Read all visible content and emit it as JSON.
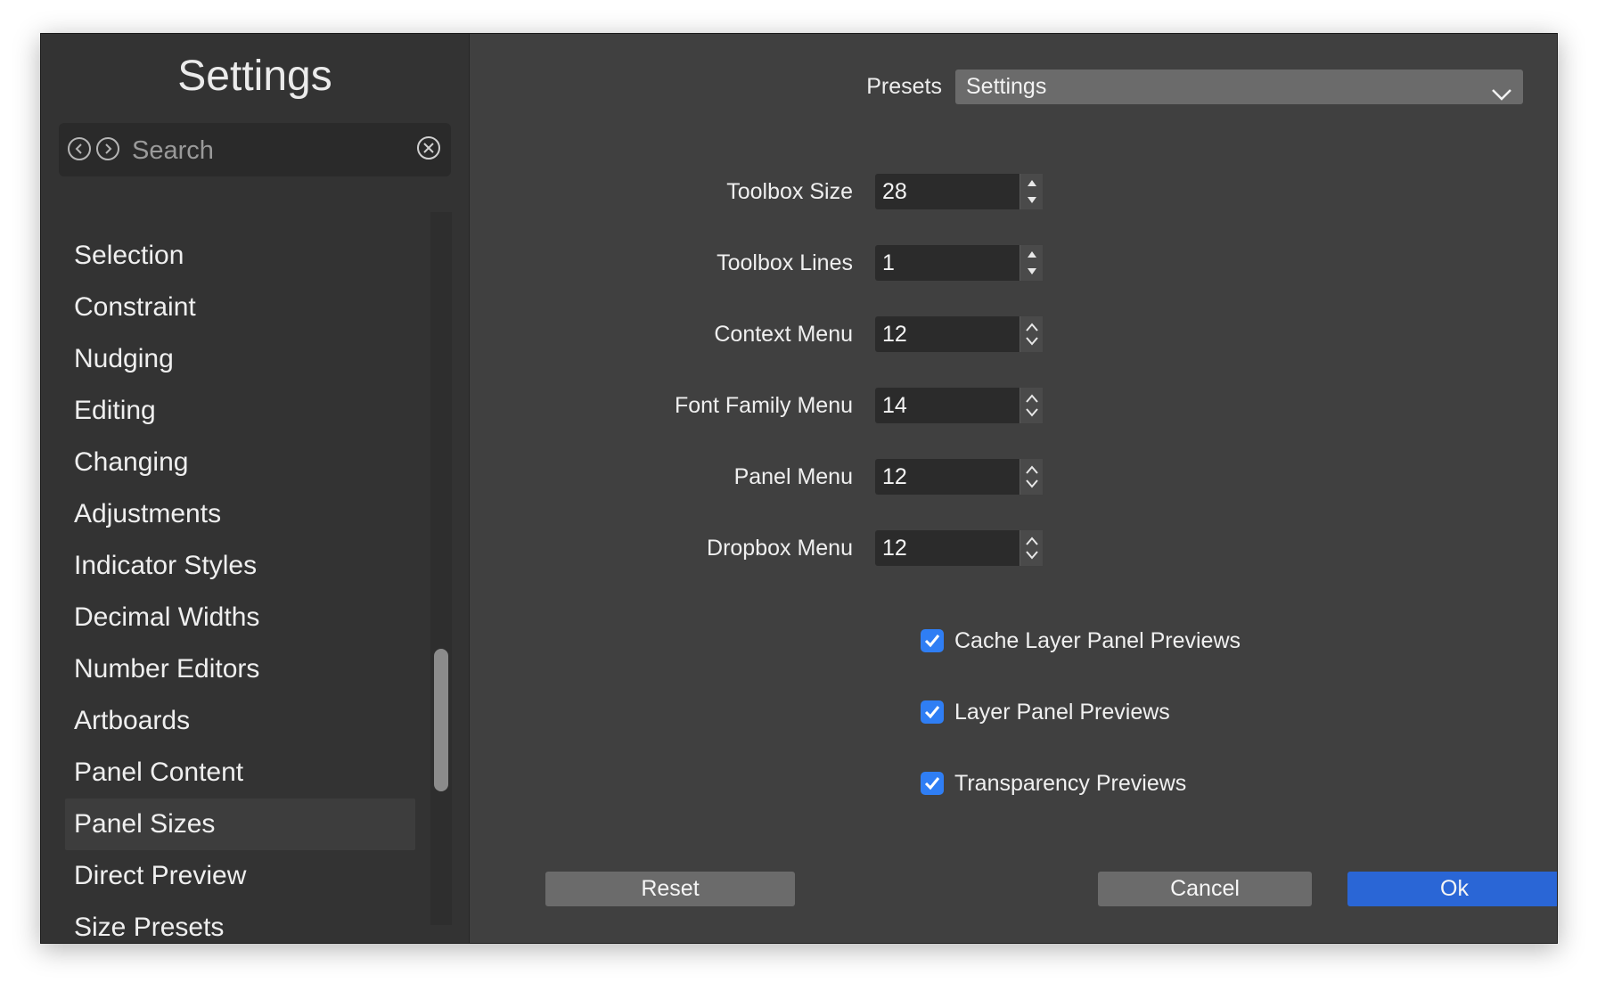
{
  "sidebar": {
    "title": "Settings",
    "search": {
      "placeholder": "Search"
    },
    "items": [
      {
        "label": "Selection"
      },
      {
        "label": "Constraint"
      },
      {
        "label": "Nudging"
      },
      {
        "label": "Editing"
      },
      {
        "label": "Changing"
      },
      {
        "label": "Adjustments"
      },
      {
        "label": "Indicator Styles"
      },
      {
        "label": "Decimal Widths"
      },
      {
        "label": "Number Editors"
      },
      {
        "label": "Artboards"
      },
      {
        "label": "Panel Content"
      },
      {
        "label": "Panel Sizes"
      },
      {
        "label": "Direct Preview"
      },
      {
        "label": "Size Presets"
      }
    ],
    "active_item": "Panel Sizes"
  },
  "presets": {
    "label": "Presets",
    "value": "Settings"
  },
  "fields": [
    {
      "label": "Toolbox Size",
      "value": "28",
      "stepper": "arrows"
    },
    {
      "label": "Toolbox Lines",
      "value": "1",
      "stepper": "arrows"
    },
    {
      "label": "Context Menu",
      "value": "12",
      "stepper": "chevrons"
    },
    {
      "label": "Font Family Menu",
      "value": "14",
      "stepper": "chevrons"
    },
    {
      "label": "Panel Menu",
      "value": "12",
      "stepper": "chevrons"
    },
    {
      "label": "Dropbox Menu",
      "value": "12",
      "stepper": "chevrons"
    }
  ],
  "checkboxes": [
    {
      "label": "Cache Layer Panel Previews",
      "checked": true
    },
    {
      "label": "Layer Panel Previews",
      "checked": true
    },
    {
      "label": "Transparency Previews",
      "checked": true
    }
  ],
  "buttons": {
    "reset": "Reset",
    "cancel": "Cancel",
    "ok": "Ok"
  },
  "colors": {
    "window_bg": "#404040",
    "sidebar_bg": "#333333",
    "accent_blue": "#2a66d6",
    "checkbox_blue": "#2f7ef4",
    "button_gray": "#6b6b6b"
  }
}
